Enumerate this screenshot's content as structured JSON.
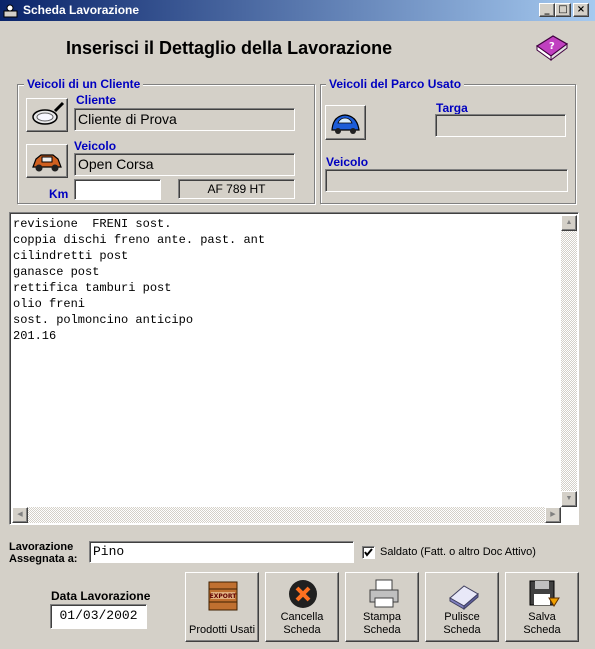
{
  "window": {
    "title": "Scheda Lavorazione",
    "controls": {
      "minimize": "_",
      "maximize": "□",
      "close": "×"
    }
  },
  "header": {
    "title": "Inserisci il Dettaglio della Lavorazione",
    "icon": "help-book-icon"
  },
  "cliente_group": {
    "label": "Veicoli di un Cliente",
    "cliente_label": "Cliente",
    "cliente_value": "Cliente di Prova",
    "veicolo_label": "Veicolo",
    "veicolo_value": "Open Corsa",
    "km_label": "Km",
    "km_value": "",
    "targa_value": "AF 789 HT"
  },
  "usato_group": {
    "label": "Veicoli del Parco Usato",
    "targa_label": "Targa",
    "targa_value": "",
    "veicolo_label": "Veicolo",
    "veicolo_value": ""
  },
  "memo": {
    "text": "revisione  FRENI sost.\ncoppia dischi freno ante. past. ant\ncilindretti post\nganasce post\nrettifica tamburi post\nolio freni\nsost. polmoncino anticipo\n201.16"
  },
  "assegnata": {
    "label": "Lavorazione\nAssegnata a:",
    "value": "Pino"
  },
  "saldato": {
    "checked": true,
    "label": "Saldato (Fatt. o altro Doc Attivo)"
  },
  "data_lavorazione": {
    "label": "Data Lavorazione",
    "value": "01/03/2002"
  },
  "buttons": [
    {
      "label": "Prodotti Usati",
      "icon": "export-crate-icon"
    },
    {
      "label": "Cancella\nScheda",
      "icon": "cancel-x-icon"
    },
    {
      "label": "Stampa\nScheda",
      "icon": "printer-icon"
    },
    {
      "label": "Pulisce\nScheda",
      "icon": "eraser-icon"
    },
    {
      "label": "Salva\nScheda",
      "icon": "floppy-save-icon"
    }
  ],
  "colors": {
    "titlebar_start": "#0a246a",
    "titlebar_end": "#a6caf0",
    "label_blue": "#0000c0",
    "face": "#d4d0c8"
  }
}
